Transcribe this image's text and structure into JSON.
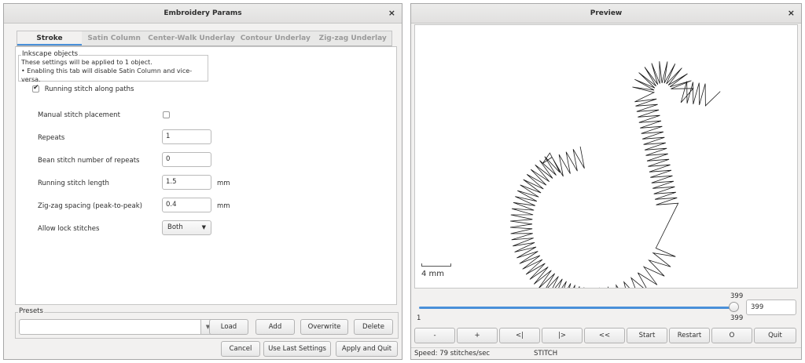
{
  "params_window": {
    "title": "Embroidery Params",
    "close": "×",
    "tabs": [
      "Stroke",
      "Satin Column",
      "Center-Walk Underlay",
      "Contour Underlay",
      "Zig-zag Underlay"
    ],
    "active_tab": "Stroke",
    "info": {
      "legend": "Inkscape objects",
      "line1": "These settings will be applied to 1 object.",
      "line2": "• Enabling this tab will disable Satin Column and vice-versa."
    },
    "enable_label": "Running stitch along paths",
    "enable_checked": true,
    "params": {
      "manual": {
        "label": "Manual stitch placement",
        "checked": false
      },
      "repeats": {
        "label": "Repeats",
        "value": "1"
      },
      "bean": {
        "label": "Bean stitch number of repeats",
        "value": "0"
      },
      "length": {
        "label": "Running stitch length",
        "value": "1.5",
        "unit": "mm"
      },
      "zigzag": {
        "label": "Zig-zag spacing (peak-to-peak)",
        "value": "0.4",
        "unit": "mm"
      },
      "lock": {
        "label": "Allow lock stitches",
        "value": "Both"
      }
    },
    "presets": {
      "legend": "Presets",
      "value": "",
      "load": "Load",
      "add": "Add",
      "overwrite": "Overwrite",
      "delete": "Delete"
    },
    "footer": {
      "cancel": "Cancel",
      "use_last": "Use Last Settings",
      "apply": "Apply and Quit"
    }
  },
  "preview_window": {
    "title": "Preview",
    "close": "×",
    "scale_label": "4 mm",
    "slider": {
      "min": "1",
      "max": "399",
      "current": "399",
      "value": "399"
    },
    "controls": [
      "-",
      "+",
      "<|",
      "|>",
      "<<",
      "Start",
      "Restart",
      "O",
      "Quit"
    ],
    "status": {
      "speed": "Speed: 79 stitches/sec",
      "mode": "STITCH"
    }
  },
  "colors": {
    "accent": "#4a90d9",
    "stitch": "#1a1a1a"
  }
}
